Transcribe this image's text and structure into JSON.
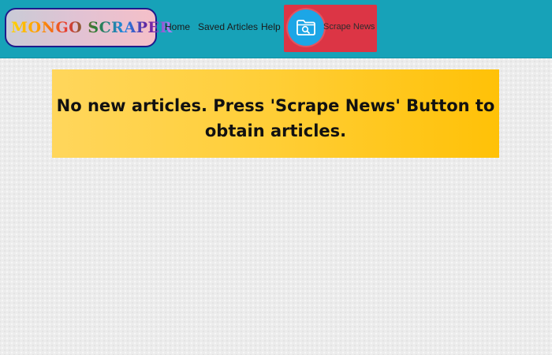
{
  "navbar": {
    "brand": "MONGO SCRAPER",
    "links": [
      {
        "label": "Home"
      },
      {
        "label": "Saved Articles"
      },
      {
        "label": "Help"
      }
    ],
    "scrape_button": {
      "label": "Scrape News",
      "icon": "folder-search-icon"
    }
  },
  "main": {
    "alert_message": "No new articles. Press 'Scrape News' Button to obtain articles."
  },
  "colors": {
    "navbar": "#17a2b8",
    "scrape_button": "#dc3545",
    "scrape_icon_bg": "#1ca6e6",
    "alert": "#ffc107"
  }
}
